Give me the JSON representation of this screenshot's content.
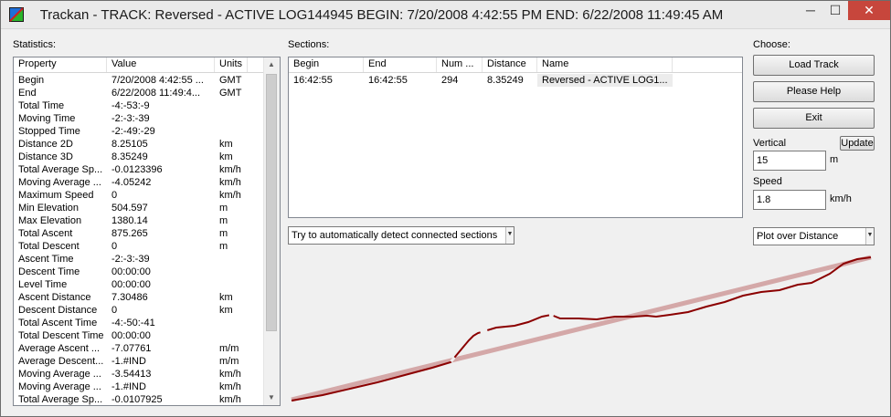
{
  "window": {
    "title": "Trackan - TRACK: Reversed - ACTIVE LOG144945    BEGIN: 7/20/2008 4:42:55 PM    END: 6/22/2008 11:49:45 AM",
    "controls": {
      "minimize": "─",
      "maximize": "☐",
      "close": "✕"
    }
  },
  "statistics": {
    "label": "Statistics:",
    "columns": [
      "Property",
      "Value",
      "Units"
    ],
    "rows": [
      [
        "Begin",
        "7/20/2008 4:42:55 ...",
        "GMT"
      ],
      [
        "End",
        "6/22/2008 11:49:4...",
        "GMT"
      ],
      [
        "Total Time",
        "-4:-53:-9",
        ""
      ],
      [
        "Moving Time",
        "-2:-3:-39",
        ""
      ],
      [
        "Stopped Time",
        "-2:-49:-29",
        ""
      ],
      [
        "Distance 2D",
        "8.25105",
        "km"
      ],
      [
        "Distance 3D",
        "8.35249",
        "km"
      ],
      [
        "Total Average Sp...",
        "-0.0123396",
        "km/h"
      ],
      [
        "Moving Average ...",
        "-4.05242",
        "km/h"
      ],
      [
        "Maximum Speed",
        "0",
        "km/h"
      ],
      [
        "Min Elevation",
        "504.597",
        "m"
      ],
      [
        "Max Elevation",
        "1380.14",
        "m"
      ],
      [
        "Total Ascent",
        "875.265",
        "m"
      ],
      [
        "Total Descent",
        "0",
        "m"
      ],
      [
        "Ascent Time",
        "-2:-3:-39",
        ""
      ],
      [
        "Descent Time",
        "00:00:00",
        ""
      ],
      [
        "Level Time",
        "00:00:00",
        ""
      ],
      [
        "Ascent Distance",
        "7.30486",
        "km"
      ],
      [
        "Descent Distance",
        "0",
        "km"
      ],
      [
        "Total Ascent Time",
        "-4:-50:-41",
        ""
      ],
      [
        "Total Descent Time",
        "00:00:00",
        ""
      ],
      [
        "Average Ascent ...",
        "-7.07761",
        "m/m"
      ],
      [
        "Average Descent...",
        "-1.#IND",
        "m/m"
      ],
      [
        "Moving Average ...",
        "-3.54413",
        "km/h"
      ],
      [
        "Moving Average ...",
        "-1.#IND",
        "km/h"
      ],
      [
        "Total Average Sp...",
        "-0.0107925",
        "km/h"
      ]
    ]
  },
  "sections": {
    "label": "Sections:",
    "columns": [
      "Begin",
      "End",
      "Num ...",
      "Distance",
      "Name"
    ],
    "rows": [
      [
        "16:42:55",
        "16:42:55",
        "294",
        "8.35249",
        "Reversed - ACTIVE LOG1..."
      ]
    ],
    "detect_mode": "Try to automatically detect connected sections"
  },
  "choose": {
    "label": "Choose:",
    "load_track": "Load Track",
    "please_help": "Please Help",
    "exit": "Exit",
    "vertical_label": "Vertical",
    "update": "Update",
    "vertical_value": "15",
    "vertical_unit": "m",
    "speed_label": "Speed",
    "speed_value": "1.8",
    "speed_unit": "km/h",
    "plot_mode": "Plot over Distance"
  },
  "colors": {
    "profile_line": "#8b0000",
    "trend_line": "#d4a8a8",
    "close_button": "#c7463c"
  }
}
